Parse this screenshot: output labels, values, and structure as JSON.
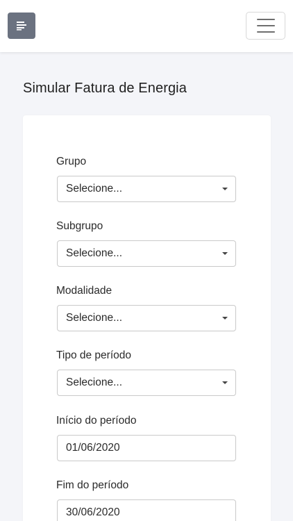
{
  "header": {
    "sidebar_toggle_icon": "align-left-icon",
    "menu_icon": "hamburger-icon"
  },
  "page": {
    "title": "Simular Fatura de Energia"
  },
  "form": {
    "grupo": {
      "label": "Grupo",
      "value": "Selecione..."
    },
    "subgrupo": {
      "label": "Subgrupo",
      "value": "Selecione..."
    },
    "modalidade": {
      "label": "Modalidade",
      "value": "Selecione..."
    },
    "tipo_periodo": {
      "label": "Tipo de período",
      "value": "Selecione..."
    },
    "inicio_periodo": {
      "label": "Início do período",
      "value": "01/06/2020"
    },
    "fim_periodo": {
      "label": "Fim do período",
      "value": "30/06/2020"
    }
  },
  "colors": {
    "sidebar_button": "#6b7280",
    "background": "#f4f5f9",
    "card": "#ffffff"
  }
}
